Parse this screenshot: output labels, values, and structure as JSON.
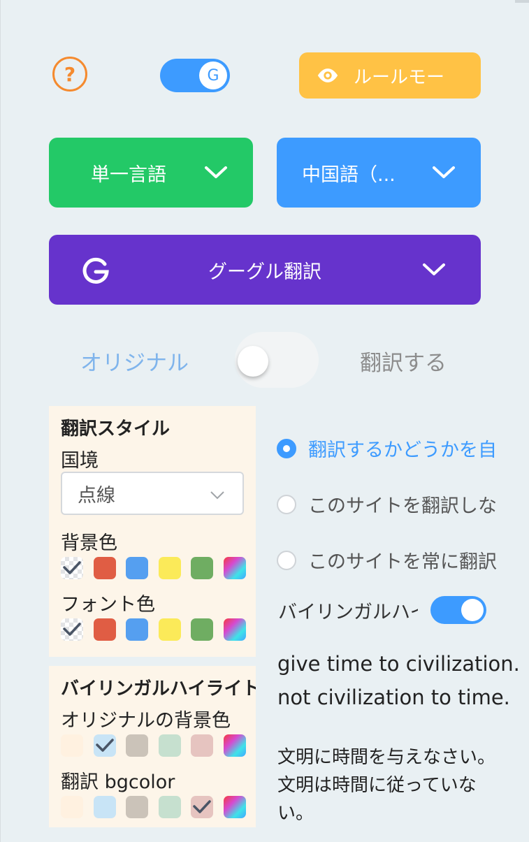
{
  "header": {
    "help_icon": "question-circle",
    "translate_toggle": {
      "on": true,
      "knob_label": "G"
    },
    "rule_mode_button": {
      "label": "ルールモー",
      "icon": "eye"
    }
  },
  "selectors": {
    "mode": {
      "label": "単一言語"
    },
    "target_language": {
      "label": "中国語（..."
    },
    "engine": {
      "label": "グーグル翻訳",
      "icon": "google-g"
    }
  },
  "view_switch": {
    "original_label": "オリジナル",
    "translate_label": "翻訳する",
    "state": "original"
  },
  "translation_style": {
    "title": "翻訳スタイル",
    "border_label": "国境",
    "border_value": "点線",
    "background_label": "背景色",
    "font_color_label": "フォント色",
    "palette": [
      "transparent",
      "#e05d44",
      "#559ff0",
      "#fbea59",
      "#6fad62",
      "rainbow"
    ],
    "background_selected": 0,
    "font_color_selected": 0
  },
  "bilingual_highlight": {
    "title": "バイリンガルハイライト",
    "original_bg_label": "オリジナルの背景色",
    "translation_bg_label": "翻訳 bgcolor",
    "palette": [
      "#fff1e0",
      "#c8e4f6",
      "#cbc3b9",
      "#c6e0cf",
      "#e6c4c0",
      "rainbow"
    ],
    "original_selected": 1,
    "translation_selected": 4
  },
  "site_options": [
    {
      "label": "翻訳するかどうかを自動で判断する",
      "selected": true
    },
    {
      "label": "このサイトを翻訳しない",
      "selected": false
    },
    {
      "label": "このサイトを常に翻訳する",
      "selected": false
    }
  ],
  "bilingual_toggle": {
    "label": "バイリンガルハイライト",
    "on": true
  },
  "preview": {
    "original_lines": [
      "give time to civilization.",
      "not civilization to time."
    ],
    "translation_lines": [
      "文明に時間を与えなさい。",
      "文明は時間に従っていない。"
    ]
  },
  "colors": {
    "accent_blue": "#3d9bff",
    "green": "#23c967",
    "purple": "#6633cc",
    "yellow": "#ffc245",
    "orange": "#f58a2e"
  }
}
